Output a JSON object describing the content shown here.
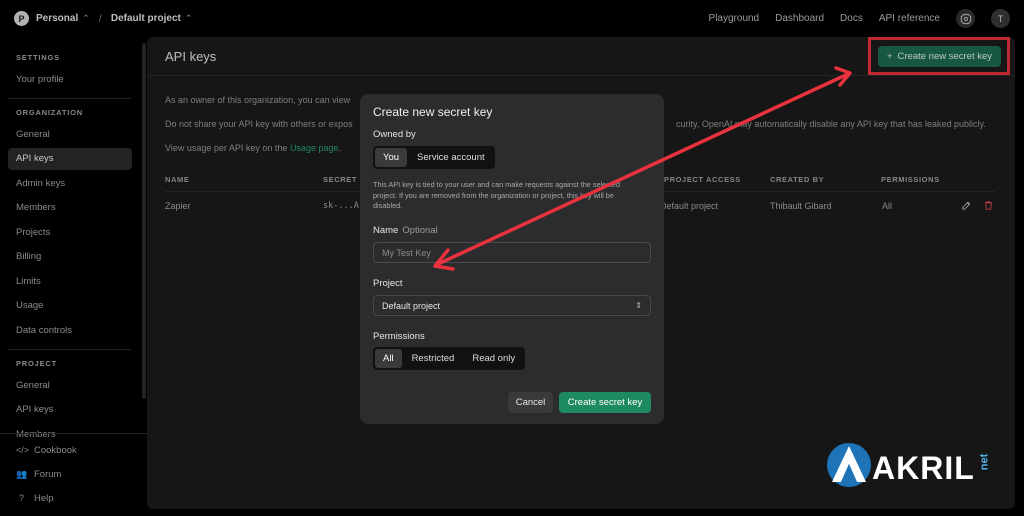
{
  "topbar": {
    "org_initial": "P",
    "org_name": "Personal",
    "separator": "/",
    "project_name": "Default project",
    "nav": [
      "Playground",
      "Dashboard",
      "Docs",
      "API reference"
    ],
    "avatar_initial": "T"
  },
  "sidebar": {
    "settings_heading": "SETTINGS",
    "settings_items": [
      "Your profile"
    ],
    "organization_heading": "ORGANIZATION",
    "organization_items": [
      "General",
      "API keys",
      "Admin keys",
      "Members",
      "Projects",
      "Billing",
      "Limits",
      "Usage",
      "Data controls"
    ],
    "active_item": "API keys",
    "project_heading": "PROJECT",
    "project_items": [
      "General",
      "API keys",
      "Members"
    ],
    "footer_items": [
      "Cookbook",
      "Forum",
      "Help"
    ]
  },
  "main": {
    "title": "API keys",
    "create_button": "Create new secret key",
    "para1": "As an owner of this organization, you can view",
    "para2_left": "Do not share your API key with others or expos",
    "para2_right": "curity, OpenAI may automatically disable any API key that has leaked publicly.",
    "para3_prefix": "View usage per API key on the",
    "para3_link": "Usage page",
    "para3_suffix": ".",
    "columns": [
      "NAME",
      "SECRET",
      "PROJECT ACCESS",
      "CREATED BY",
      "PERMISSIONS"
    ],
    "rows": [
      {
        "name": "Zapier",
        "secret": "sk-...A",
        "project_access": "Default project",
        "created_by": "Thibault Gibard",
        "permissions": "All"
      }
    ]
  },
  "modal": {
    "title": "Create new secret key",
    "owned_by_label": "Owned by",
    "owned_by_options": [
      "You",
      "Service account"
    ],
    "owned_by_selected": "You",
    "help_text": "This API key is tied to your user and can make requests against the selected project. If you are removed from the organization or project, this key will be disabled.",
    "name_label": "Name",
    "name_optional": "Optional",
    "name_placeholder": "My Test Key",
    "project_label": "Project",
    "project_value": "Default project",
    "permissions_label": "Permissions",
    "permissions_options": [
      "All",
      "Restricted",
      "Read only"
    ],
    "permissions_selected": "All",
    "cancel_button": "Cancel",
    "create_button": "Create secret key"
  },
  "annotation": {
    "color": "#e8323d"
  },
  "watermark": {
    "text": "AKRIL",
    "suffix": "net"
  },
  "colors": {
    "accent_green": "#1e8a61",
    "link_green": "#2aa37a",
    "delete_red": "#e5484d"
  }
}
